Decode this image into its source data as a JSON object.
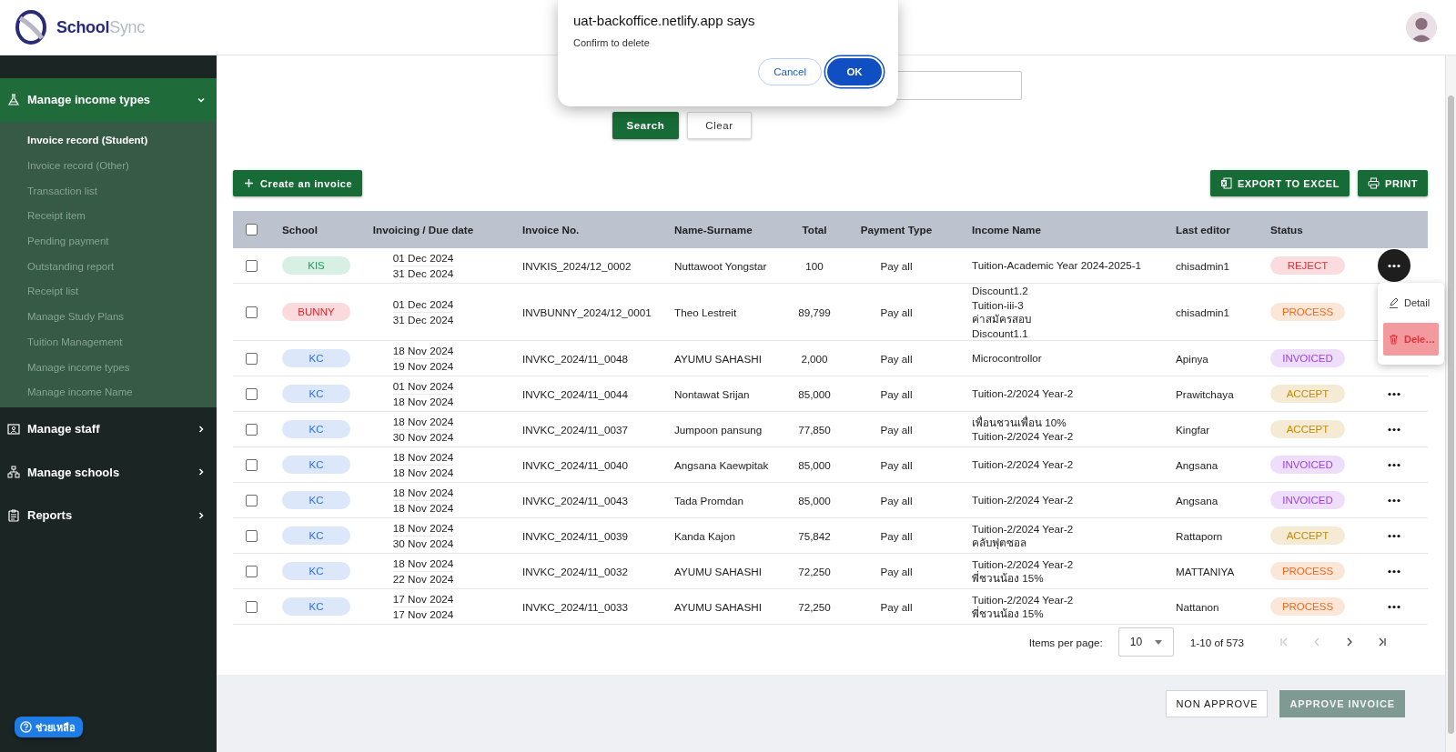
{
  "header": {
    "brand": "School",
    "brand_suffix": "Sync"
  },
  "sidebar": {
    "items": [
      {
        "label": "Manage income types",
        "expanded": true,
        "children": [
          {
            "label": "Invoice record (Student)",
            "selected": true
          },
          {
            "label": "Invoice record (Other)",
            "selected": false
          },
          {
            "label": "Transaction list",
            "selected": false
          },
          {
            "label": "Receipt item",
            "selected": false
          },
          {
            "label": "Pending payment",
            "selected": false
          },
          {
            "label": "Outstanding report",
            "selected": false
          },
          {
            "label": "Receipt list",
            "selected": false
          },
          {
            "label": "Manage Study Plans",
            "selected": false
          },
          {
            "label": "Tuition Management",
            "selected": false
          },
          {
            "label": "Manage income types",
            "selected": false
          },
          {
            "label": "Manage income Name",
            "selected": false
          }
        ]
      },
      {
        "label": "Manage staff",
        "expanded": false
      },
      {
        "label": "Manage schools",
        "expanded": false
      },
      {
        "label": "Reports",
        "expanded": false
      }
    ],
    "help_button": "ช่วยเหลือ"
  },
  "search": {
    "search_button": "Search",
    "clear_button": "Clear"
  },
  "toolbar": {
    "create_button": "Create an invoice",
    "export_button": "EXPORT TO EXCEL",
    "print_button": "PRINT"
  },
  "table": {
    "header_checked": false,
    "columns": [
      "School",
      "Invoicing / Due date",
      "Invoice No.",
      "Name-Surname",
      "Total",
      "Payment Type",
      "Income Name",
      "Last editor",
      "Status"
    ],
    "rows": [
      {
        "checked": false,
        "school": {
          "label": "KIS",
          "color": "#17a05a"
        },
        "dates": [
          "01 Dec 2024",
          "31 Dec 2024"
        ],
        "invoice_no": "INVKIS_2024/12_0002",
        "name": "Nuttawoot Yongstar",
        "total": "100",
        "payment_type": "Pay all",
        "income_names": [
          "Tuition-Academic Year 2024-2025-1"
        ],
        "last_editor": "chisadmin1",
        "status": {
          "label": "REJECT",
          "color": "#e0313c"
        },
        "action": {
          "open": true
        }
      },
      {
        "checked": false,
        "school": {
          "label": "BUNNY",
          "color": "#e0242f"
        },
        "dates": [
          "01 Dec 2024",
          "31 Dec 2024"
        ],
        "invoice_no": "INVBUNNY_2024/12_0001",
        "name": "Theo Lestreit",
        "total": "89,799",
        "payment_type": "Pay all",
        "income_names": [
          "Discount1.2",
          "Tuition-iii-3",
          "ค่าสมัครสอบ",
          "Discount1.1"
        ],
        "last_editor": "chisadmin1",
        "status": {
          "label": "PROCESS",
          "color": "#f06a1a"
        }
      },
      {
        "checked": false,
        "school": {
          "label": "KC",
          "color": "#2f6fe0"
        },
        "dates": [
          "18 Nov 2024",
          "19 Nov 2024"
        ],
        "invoice_no": "INVKC_2024/11_0048",
        "name": "AYUMU SAHASHI",
        "total": "2,000",
        "payment_type": "Pay all",
        "income_names": [
          "Microcontrollor"
        ],
        "last_editor": "Apinya",
        "status": {
          "label": "INVOICED",
          "color": "#9b3df0"
        }
      },
      {
        "checked": false,
        "school": {
          "label": "KC",
          "color": "#2f6fe0"
        },
        "dates": [
          "01 Nov 2024",
          "18 Nov 2024"
        ],
        "invoice_no": "INVKC_2024/11_0044",
        "name": "Nontawat Srijan",
        "total": "85,000",
        "payment_type": "Pay all",
        "income_names": [
          "Tuition-2/2024 Year-2"
        ],
        "last_editor": "Prawitchaya",
        "status": {
          "label": "ACCEPT",
          "color": "#c48a00"
        },
        "action": {
          "open": false
        }
      },
      {
        "checked": false,
        "school": {
          "label": "KC",
          "color": "#2f6fe0"
        },
        "dates": [
          "18 Nov 2024",
          "30 Nov 2024"
        ],
        "invoice_no": "INVKC_2024/11_0037",
        "name": "Jumpoon pansung",
        "total": "77,850",
        "payment_type": "Pay all",
        "income_names": [
          "เพื่อนชวนเพื่อน 10%",
          "Tuition-2/2024 Year-2"
        ],
        "last_editor": "Kingfar",
        "status": {
          "label": "ACCEPT",
          "color": "#c48a00"
        },
        "action": {
          "open": false
        }
      },
      {
        "checked": false,
        "school": {
          "label": "KC",
          "color": "#2f6fe0"
        },
        "dates": [
          "18 Nov 2024",
          "18 Nov 2024"
        ],
        "invoice_no": "INVKC_2024/11_0040",
        "name": "Angsana Kaewpitak",
        "total": "85,000",
        "payment_type": "Pay all",
        "income_names": [
          "Tuition-2/2024 Year-2"
        ],
        "last_editor": "Angsana",
        "status": {
          "label": "INVOICED",
          "color": "#9b3df0"
        },
        "action": {
          "open": false
        }
      },
      {
        "checked": false,
        "school": {
          "label": "KC",
          "color": "#2f6fe0"
        },
        "dates": [
          "18 Nov 2024",
          "18 Nov 2024"
        ],
        "invoice_no": "INVKC_2024/11_0043",
        "name": "Tada Promdan",
        "total": "85,000",
        "payment_type": "Pay all",
        "income_names": [
          "Tuition-2/2024 Year-2"
        ],
        "last_editor": "Angsana",
        "status": {
          "label": "INVOICED",
          "color": "#9b3df0"
        },
        "action": {
          "open": false
        }
      },
      {
        "checked": false,
        "school": {
          "label": "KC",
          "color": "#2f6fe0"
        },
        "dates": [
          "18 Nov 2024",
          "30 Nov 2024"
        ],
        "invoice_no": "INVKC_2024/11_0039",
        "name": "Kanda Kajon",
        "total": "75,842",
        "payment_type": "Pay all",
        "income_names": [
          "Tuition-2/2024 Year-2",
          "คลับฟุตซอล"
        ],
        "last_editor": "Rattaporn",
        "status": {
          "label": "ACCEPT",
          "color": "#c48a00"
        },
        "action": {
          "open": false
        }
      },
      {
        "checked": false,
        "school": {
          "label": "KC",
          "color": "#2f6fe0"
        },
        "dates": [
          "18 Nov 2024",
          "22 Nov 2024"
        ],
        "invoice_no": "INVKC_2024/11_0032",
        "name": "AYUMU SAHASHI",
        "total": "72,250",
        "payment_type": "Pay all",
        "income_names": [
          "Tuition-2/2024 Year-2",
          "พี่ชวนน้อง 15%"
        ],
        "last_editor": "MATTANIYA",
        "status": {
          "label": "PROCESS",
          "color": "#f06a1a"
        },
        "action": {
          "open": false
        }
      },
      {
        "checked": false,
        "school": {
          "label": "KC",
          "color": "#2f6fe0"
        },
        "dates": [
          "17 Nov 2024",
          "17 Nov 2024"
        ],
        "invoice_no": "INVKC_2024/11_0033",
        "name": "AYUMU SAHASHI",
        "total": "72,250",
        "payment_type": "Pay all",
        "income_names": [
          "Tuition-2/2024 Year-2",
          "พี่ชวนน้อง 15%"
        ],
        "last_editor": "Nattanon",
        "status": {
          "label": "PROCESS",
          "color": "#f06a1a"
        },
        "action": {
          "open": false
        }
      }
    ]
  },
  "row_menu": {
    "items": [
      {
        "kind": "edit",
        "label": "Detail",
        "selected": false
      },
      {
        "kind": "delete",
        "label": "Dele…",
        "selected": true
      }
    ]
  },
  "pager": {
    "label": "Items per page:",
    "page_size": "10",
    "range": "1-10 of 573",
    "buttons": [
      {
        "kind": "first",
        "disabled": true
      },
      {
        "kind": "prev",
        "disabled": true
      },
      {
        "kind": "next",
        "disabled": false
      },
      {
        "kind": "last",
        "disabled": false
      }
    ]
  },
  "footer": {
    "buttons": [
      {
        "label": "NON APPROVE",
        "disabled": false
      },
      {
        "label": "APPROVE INVOICE",
        "disabled": true
      }
    ]
  },
  "dialog": {
    "title": "uat-backoffice.netlify.app says",
    "message": "Confirm to delete",
    "buttons": [
      {
        "label": "Cancel",
        "kind": "secondary",
        "focused": false
      },
      {
        "label": "OK",
        "kind": "primary",
        "focused": true
      }
    ]
  }
}
